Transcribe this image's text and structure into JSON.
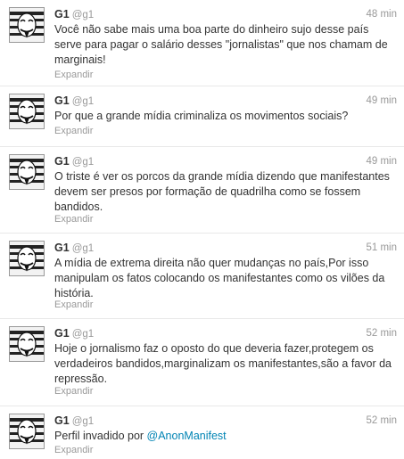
{
  "tweets": [
    {
      "name": "G1",
      "handle": "@g1",
      "time": "48 min",
      "text": "Você não sabe mais uma boa parte do dinheiro sujo desse país serve para pagar o salário desses \"jornalistas\" que nos chamam de marginais!",
      "expand": "Expandir"
    },
    {
      "name": "G1",
      "handle": "@g1",
      "time": "49 min",
      "text": "Por que a grande mídia criminaliza os movimentos sociais?",
      "expand": "Expandir"
    },
    {
      "name": "G1",
      "handle": "@g1",
      "time": "49 min",
      "text": "O triste é ver os porcos da grande mídia dizendo que manifestantes devem ser presos por formação de quadrilha como se fossem bandidos.",
      "expand": "Expandir"
    },
    {
      "name": "G1",
      "handle": "@g1",
      "time": "51 min",
      "text": "A mídia de extrema direita não quer mudanças no país,Por isso manipulam os fatos colocando os manifestantes como os vilões da história.",
      "expand": "Expandir"
    },
    {
      "name": "G1",
      "handle": "@g1",
      "time": "52 min",
      "text": "Hoje o jornalismo faz o oposto do que deveria fazer,protegem os verdadeiros bandidos,marginalizam os manifestantes,são a favor da repressão.",
      "expand": "Expandir"
    },
    {
      "name": "G1",
      "handle": "@g1",
      "time": "52 min",
      "text": "Perfil invadido por ",
      "mention": "@AnonManifest",
      "expand": "Expandir"
    }
  ],
  "icons": {
    "avatar": "anonymous-mask-avatar-icon"
  }
}
